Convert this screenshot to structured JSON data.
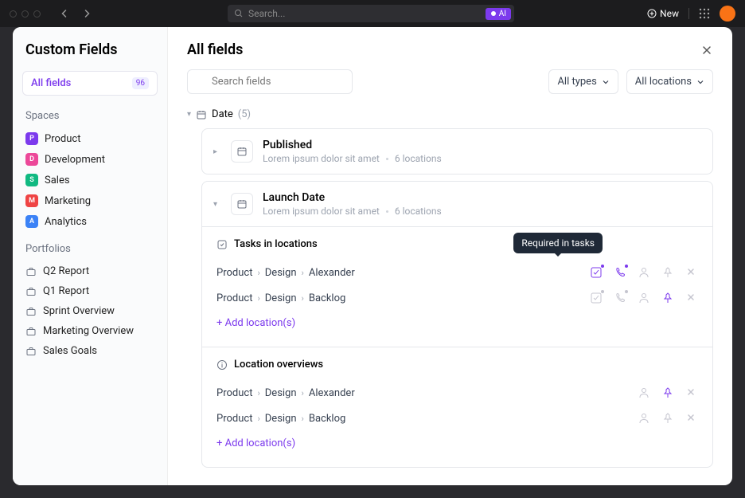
{
  "titlebar": {
    "search_placeholder": "Search...",
    "ai_label": "AI",
    "new_label": "New"
  },
  "sidebar": {
    "title": "Custom Fields",
    "all_fields": {
      "label": "All fields",
      "count": "96"
    },
    "spaces_label": "Spaces",
    "spaces": [
      {
        "letter": "P",
        "color": "#7c3aed",
        "label": "Product"
      },
      {
        "letter": "D",
        "color": "#ec4899",
        "label": "Development"
      },
      {
        "letter": "S",
        "color": "#10b981",
        "label": "Sales"
      },
      {
        "letter": "M",
        "color": "#ef4444",
        "label": "Marketing"
      },
      {
        "letter": "A",
        "color": "#3b82f6",
        "label": "Analytics"
      }
    ],
    "portfolios_label": "Portfolios",
    "portfolios": [
      {
        "label": "Q2 Report"
      },
      {
        "label": "Q1 Report"
      },
      {
        "label": "Sprint Overview"
      },
      {
        "label": "Marketing Overview"
      },
      {
        "label": "Sales Goals"
      }
    ]
  },
  "main": {
    "title": "All fields",
    "search_placeholder": "Search fields",
    "filter_types": "All types",
    "filter_locations": "All locations",
    "group": {
      "label": "Date",
      "count": "(5)"
    },
    "fields": [
      {
        "name": "Published",
        "desc": "Lorem ipsum dolor sit amet",
        "loc": "6 locations"
      },
      {
        "name": "Launch Date",
        "desc": "Lorem ipsum dolor sit amet",
        "loc": "6 locations"
      }
    ],
    "tasks_section": "Tasks in locations",
    "overview_section": "Location overviews",
    "locations": [
      {
        "a": "Product",
        "b": "Design",
        "c": "Alexander"
      },
      {
        "a": "Product",
        "b": "Design",
        "c": "Backlog"
      }
    ],
    "overview_locations": [
      {
        "a": "Product",
        "b": "Design",
        "c": "Alexander"
      },
      {
        "a": "Product",
        "b": "Design",
        "c": "Backlog"
      }
    ],
    "add_locations": "+ Add location(s)",
    "tooltip": "Required in tasks"
  }
}
